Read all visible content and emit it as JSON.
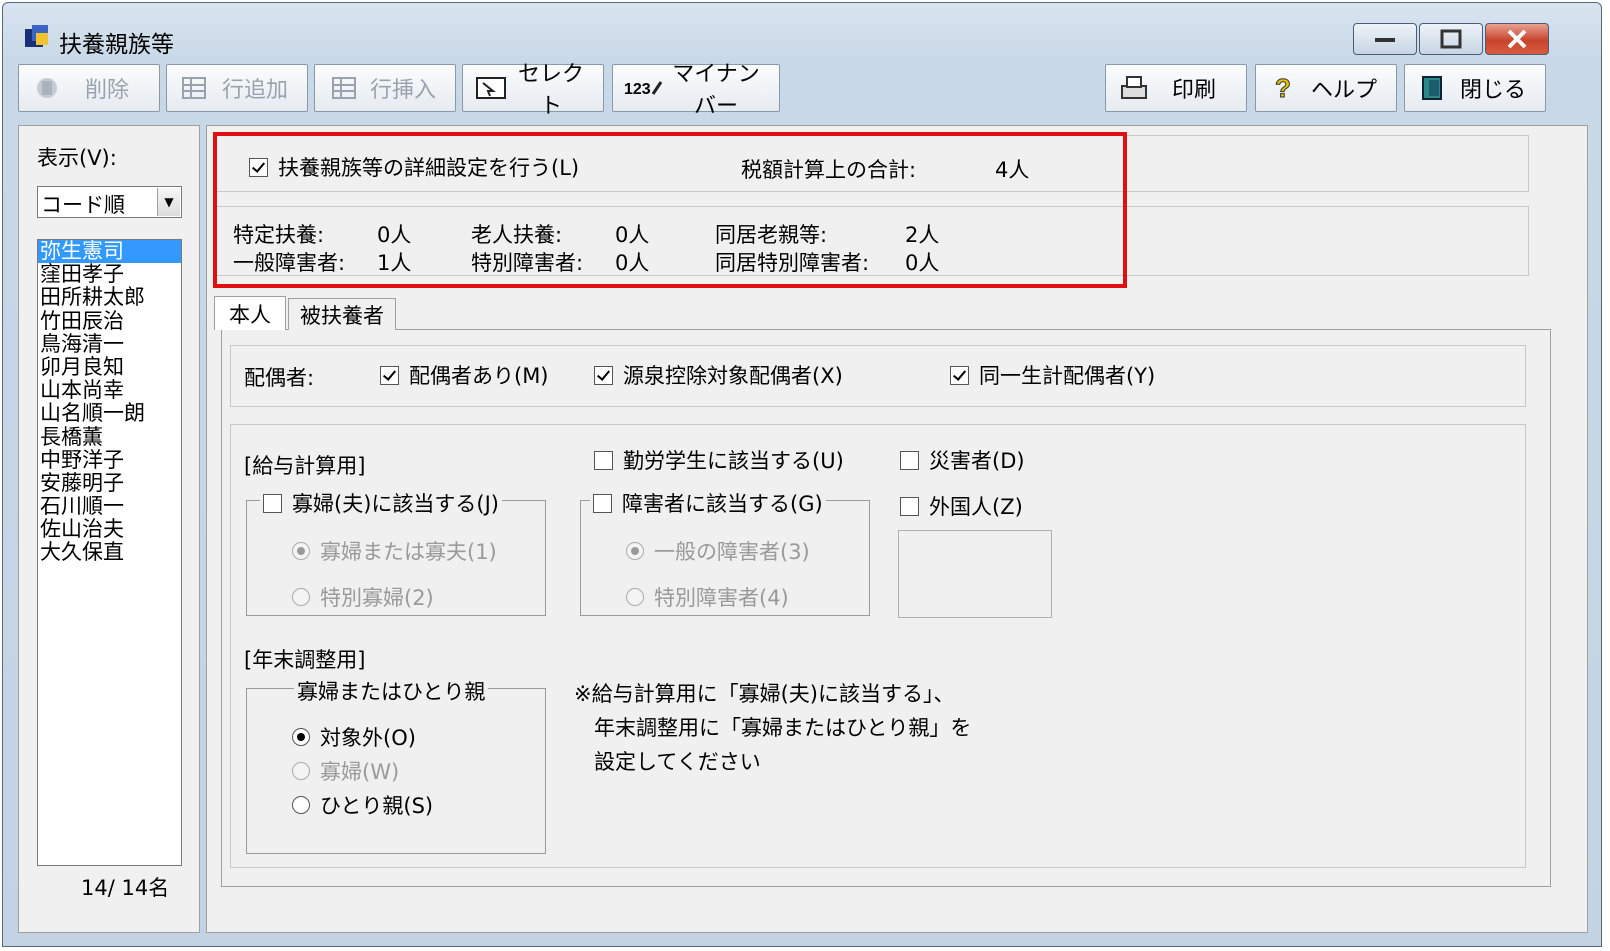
{
  "window": {
    "title": "扶養親族等"
  },
  "toolbar": {
    "delete": "削除",
    "add_row": "行追加",
    "insert_row": "行挿入",
    "select": "セレクト",
    "my_number": "マイナンバー",
    "print": "印刷",
    "help": "ヘルプ",
    "close": "閉じる"
  },
  "left": {
    "display_label": "表示(V):",
    "sort_value": "コード順",
    "employees": [
      "弥生憲司",
      "窪田孝子",
      "田所耕太郎",
      "竹田辰治",
      "鳥海清一",
      "卯月良知",
      "山本尚幸",
      "山名順一朗",
      "長橋薫",
      "中野洋子",
      "安藤明子",
      "石川順一",
      "佐山治夫",
      "大久保直"
    ],
    "count_text": "14/ 14名"
  },
  "summary": {
    "detail_checkbox": "扶養親族等の詳細設定を行う(L)",
    "tax_total_label": "税額計算上の合計:",
    "tax_total_value": "4人",
    "specific_label": "特定扶養:",
    "specific_value": "0人",
    "elderly_label": "老人扶養:",
    "elderly_value": "0人",
    "cohabit_label": "同居老親等:",
    "cohabit_value": "2人",
    "general_disabled_label": "一般障害者:",
    "general_disabled_value": "1人",
    "special_disabled_label": "特別障害者:",
    "special_disabled_value": "0人",
    "cohabit_special_label": "同居特別障害者:",
    "cohabit_special_value": "0人"
  },
  "tabs": {
    "self": "本人",
    "dependents": "被扶養者"
  },
  "spouse": {
    "label": "配偶者:",
    "has_spouse": "配偶者あり(M)",
    "withholding": "源泉控除対象配偶者(X)",
    "same_household": "同一生計配偶者(Y)"
  },
  "payroll": {
    "section": "[給与計算用]",
    "widow_check": "寡婦(夫)に該当する(J)",
    "widow_opt1": "寡婦または寡夫(1)",
    "widow_opt2": "特別寡婦(2)",
    "working_student": "勤労学生に該当する(U)",
    "disabled_check": "障害者に該当する(G)",
    "disabled_opt3": "一般の障害者(3)",
    "disabled_opt4": "特別障害者(4)",
    "disaster": "災害者(D)",
    "foreigner": "外国人(Z)"
  },
  "year_end": {
    "section": "[年末調整用]",
    "group_label": "寡婦またはひとり親",
    "opt_none": "対象外(O)",
    "opt_widow": "寡婦(W)",
    "opt_single": "ひとり親(S)",
    "note_line1": "※給与計算用に「寡婦(夫)に該当する」、",
    "note_line2": "年末調整用に「寡婦またはひとり親」を",
    "note_line3": "設定してください"
  }
}
